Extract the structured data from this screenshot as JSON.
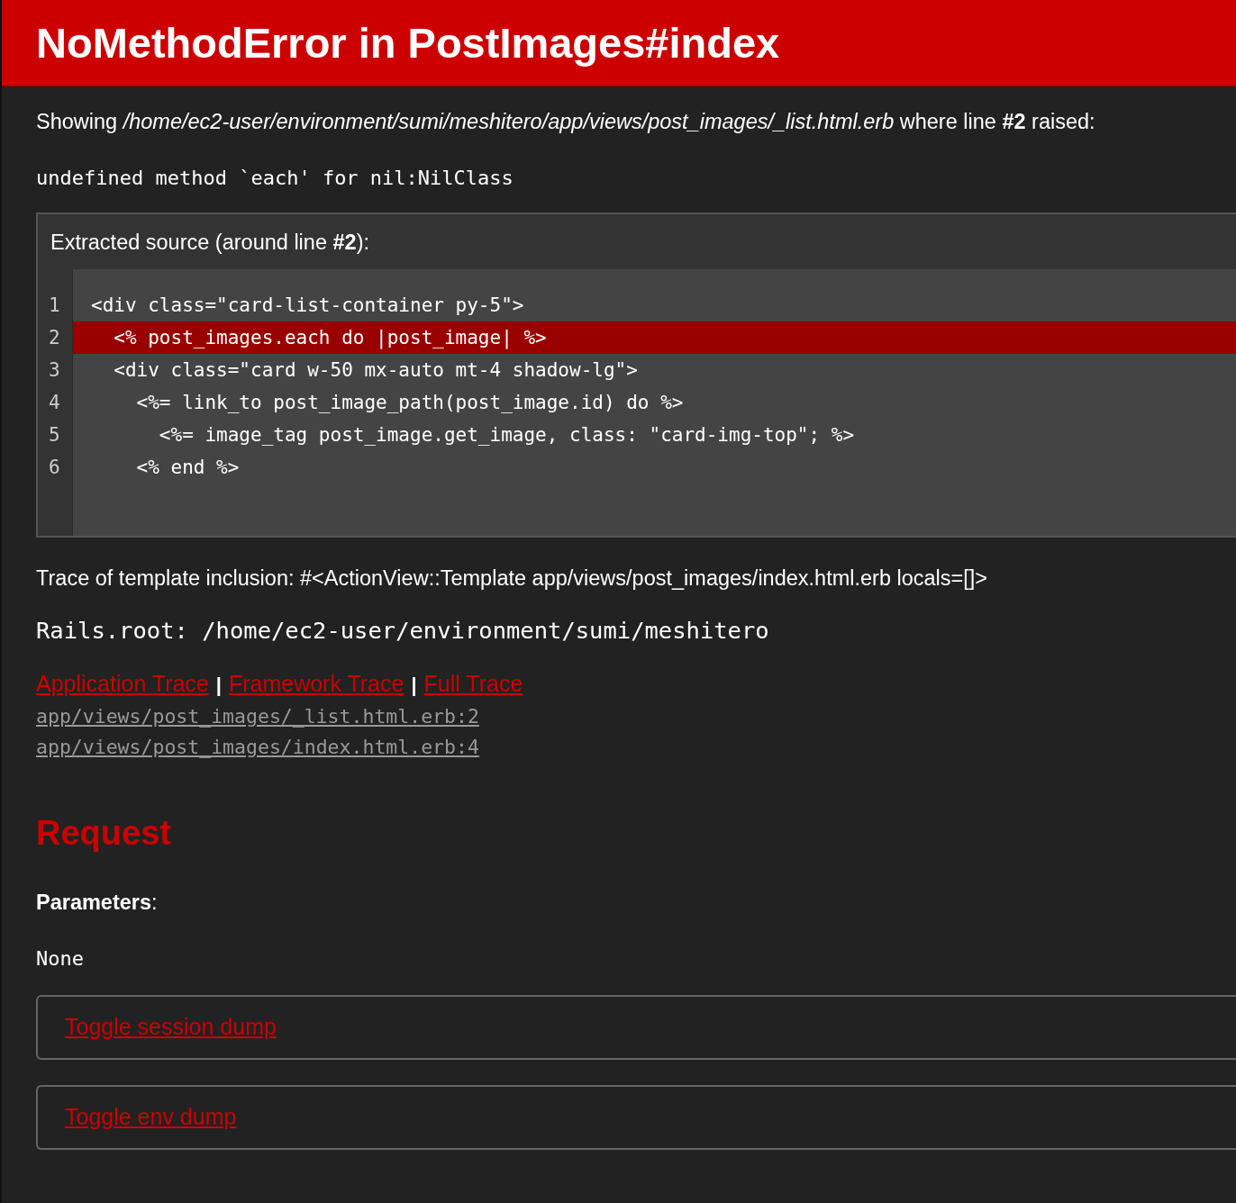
{
  "header": {
    "title": "NoMethodError in PostImages#index"
  },
  "message": "Showing */home/ec2-user/environment/sumi/meshitero/app/views/post_images/_list.html.erb* where line **#2** raised:",
  "exception": "undefined method `each' for nil:NilClass",
  "source": {
    "title": "Extracted source (around line **#2**):",
    "lines": [
      {
        "number": "1",
        "code": "<div class=\"card-list-container py-5\">",
        "selected": false
      },
      {
        "number": "2",
        "code": "  <% post_images.each do |post_image| %>",
        "selected": true
      },
      {
        "number": "3",
        "code": "  <div class=\"card w-50 mx-auto mt-4 shadow-lg\">",
        "selected": false
      },
      {
        "number": "4",
        "code": "    <%= link_to post_image_path(post_image.id) do %>",
        "selected": false
      },
      {
        "number": "5",
        "code": "      <%= image_tag post_image.get_image, class: \"card-img-top\"; %>",
        "selected": false
      },
      {
        "number": "6",
        "code": "    <% end %>",
        "selected": false
      }
    ]
  },
  "template_trace": "Trace of template inclusion: #<ActionView::Template app/views/post_images/index.html.erb locals=[]>",
  "rails_root": "Rails.root: /home/ec2-user/environment/sumi/meshitero",
  "trace_tabs": [
    {
      "kind": "link",
      "text": "Application Trace"
    },
    {
      "kind": "separator",
      "text": "|"
    },
    {
      "kind": "link",
      "text": "Framework Trace"
    },
    {
      "kind": "separator",
      "text": "|"
    },
    {
      "kind": "link",
      "text": "Full Trace"
    }
  ],
  "trace_lines": [
    "app/views/post_images/_list.html.erb:2",
    "app/views/post_images/index.html.erb:4"
  ],
  "request": {
    "heading": "Request",
    "parameters_label": "**Parameters**:",
    "parameters_value": "None"
  },
  "toggles": [
    "Toggle session dump",
    "Toggle env dump"
  ]
}
